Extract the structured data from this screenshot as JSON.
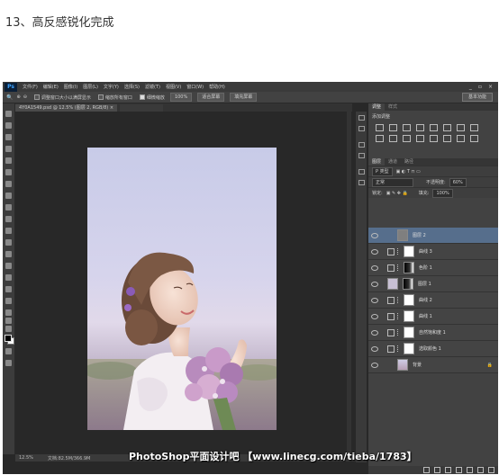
{
  "heading": "13、高反感锐化完成",
  "watermark": "PhotoShop平面设计吧 【www.linecg.com/tieba/1783】",
  "photoshop": {
    "logo": "Ps",
    "menu": [
      "文件(F)",
      "编辑(E)",
      "图像(I)",
      "图层(L)",
      "文字(Y)",
      "选择(S)",
      "滤镜(T)",
      "视图(V)",
      "窗口(W)",
      "帮助(H)"
    ],
    "window_controls": [
      "_",
      "▫",
      "×"
    ],
    "options": {
      "checkbox1": "调整窗口大小以满屏显示",
      "checkbox2": "缩放所有窗口",
      "checkbox3": "细微缩放",
      "zoom_button": "100%",
      "fit_button": "适合屏幕",
      "fill_button": "填充屏幕",
      "workspace": "基本功能"
    },
    "doc_tabs": [
      {
        "label": "4Y0A1549.psd @ 12.5% (图层 2, RGB/8) ×",
        "active": true
      },
      {
        "label": "",
        "active": false
      }
    ],
    "status": {
      "zoom": "12.5%",
      "doc_size": "文档:82.5M/366.9M"
    },
    "panels": {
      "tabs": [
        "调整",
        "样式"
      ],
      "adjust_title": "添加调整",
      "layer_tabs": [
        "图层",
        "通道",
        "路径"
      ],
      "filter_kind": "P 类型",
      "blend_mode": "正常",
      "opacity_label": "不透明度:",
      "opacity_value": "60%",
      "lock_label": "锁定:",
      "fill_label": "填充:",
      "fill_value": "100%"
    },
    "layers": [
      {
        "name": "图层 2",
        "kind": "pixel",
        "selected": true
      },
      {
        "name": "曲线 3",
        "kind": "adjust",
        "mask": "white"
      },
      {
        "name": "色阶 1",
        "kind": "adjust",
        "mask": "dark"
      },
      {
        "name": "图层 1",
        "kind": "pixel-mask",
        "mask": "dark"
      },
      {
        "name": "曲线 2",
        "kind": "adjust",
        "mask": "white"
      },
      {
        "name": "曲线 1",
        "kind": "adjust",
        "mask": "white"
      },
      {
        "name": "自然饱和度 1",
        "kind": "adjust",
        "mask": "white"
      },
      {
        "name": "选取颜色 1",
        "kind": "adjust",
        "mask": "white"
      },
      {
        "name": "背景",
        "kind": "background"
      }
    ]
  }
}
